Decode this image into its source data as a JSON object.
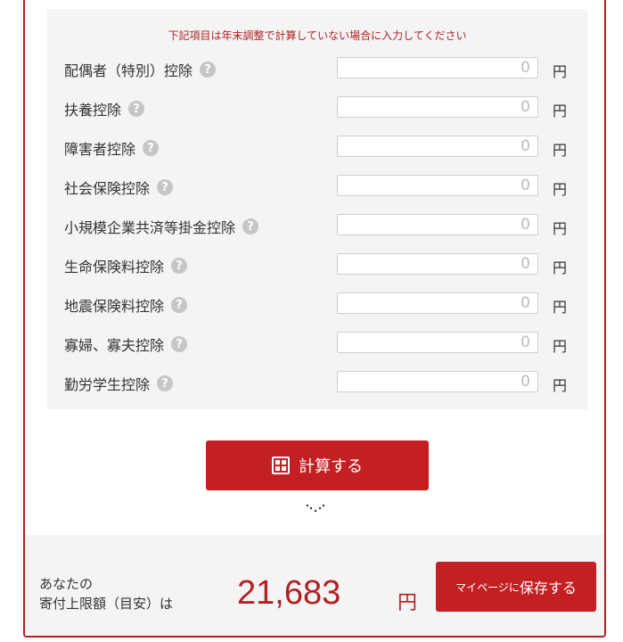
{
  "notice": "下記項目は年末調整で計算していない場合に入力してください",
  "deductions": [
    {
      "label": "配偶者（特別）控除",
      "value": "0",
      "unit": "円"
    },
    {
      "label": "扶養控除",
      "value": "0",
      "unit": "円"
    },
    {
      "label": "障害者控除",
      "value": "0",
      "unit": "円"
    },
    {
      "label": "社会保険控除",
      "value": "0",
      "unit": "円"
    },
    {
      "label": "小規模企業共済等掛金控除",
      "value": "0",
      "unit": "円"
    },
    {
      "label": "生命保険料控除",
      "value": "0",
      "unit": "円"
    },
    {
      "label": "地震保険料控除",
      "value": "0",
      "unit": "円"
    },
    {
      "label": "寡婦、寡夫控除",
      "value": "0",
      "unit": "円"
    },
    {
      "label": "勤労学生控除",
      "value": "0",
      "unit": "円"
    }
  ],
  "calc_button": {
    "label": "計算する",
    "icon": "calculator-icon"
  },
  "result": {
    "label_line1": "あなたの",
    "label_line2": "寄付上限額（目安）は",
    "amount": "21,683",
    "unit": "円"
  },
  "save_button": {
    "prefix": "マイページに",
    "label": "保存する"
  },
  "colors": {
    "accent": "#c41f22",
    "panel": "#f4f4f4"
  }
}
